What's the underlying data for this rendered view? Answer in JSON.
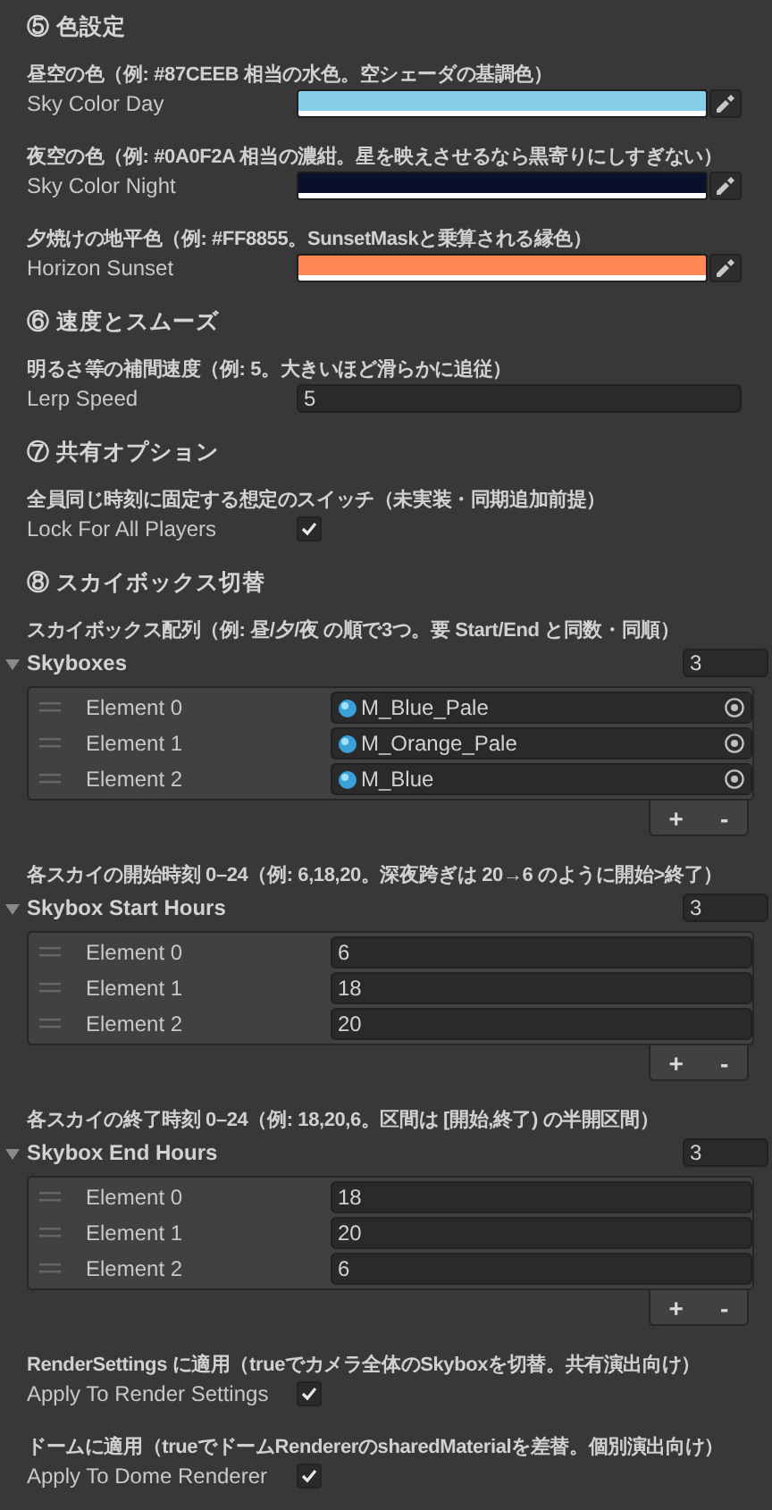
{
  "items": [
    {
      "kind": "section",
      "title": "⑤ 色設定"
    },
    {
      "kind": "color",
      "header": "昼空の色（例: #87CEEB 相当の水色。空シェーダの基調色）",
      "label": "Sky Color Day",
      "color": "#87ceeb"
    },
    {
      "kind": "color",
      "header": "夜空の色（例: #0A0F2A 相当の濃紺。星を映えさせるなら黒寄りにしすぎない）",
      "label": "Sky Color Night",
      "color": "#0a0f2a"
    },
    {
      "kind": "color",
      "header": "夕焼けの地平色（例: #FF8855。SunsetMaskと乗算される縁色）",
      "label": "Horizon Sunset",
      "color": "#ff8855"
    },
    {
      "kind": "section",
      "title": "⑥ 速度とスムーズ"
    },
    {
      "kind": "float",
      "header": "明るさ等の補間速度（例: 5。大きいほど滑らかに追従）",
      "label": "Lerp Speed",
      "value": "5"
    },
    {
      "kind": "section",
      "title": "⑦ 共有オプション"
    },
    {
      "kind": "toggle",
      "header": "全員同じ時刻に固定する想定のスイッチ（未実装・同期追加前提）",
      "label": "Lock For All Players",
      "checked": true
    },
    {
      "kind": "section",
      "title": "⑧ スカイボックス切替"
    },
    {
      "kind": "list",
      "header": "スカイボックス配列（例: 昼/夕/夜 の順で3つ。要 Start/End と同数・同順）",
      "label": "Skyboxes",
      "expanded": true,
      "count": "3",
      "add_button": "+",
      "remove_button": "-",
      "elements": [
        {
          "kind": "object",
          "label": "Element 0",
          "value": "M_Blue_Pale"
        },
        {
          "kind": "object",
          "label": "Element 1",
          "value": "M_Orange_Pale"
        },
        {
          "kind": "object",
          "label": "Element 2",
          "value": "M_Blue"
        }
      ]
    },
    {
      "kind": "list",
      "header": "各スカイの開始時刻 0–24（例: 6,18,20。深夜跨ぎは 20→6 のように開始>終了）",
      "label": "Skybox Start Hours",
      "expanded": true,
      "count": "3",
      "add_button": "+",
      "remove_button": "-",
      "elements": [
        {
          "kind": "number",
          "label": "Element 0",
          "value": "6"
        },
        {
          "kind": "number",
          "label": "Element 1",
          "value": "18"
        },
        {
          "kind": "number",
          "label": "Element 2",
          "value": "20"
        }
      ]
    },
    {
      "kind": "list",
      "header": "各スカイの終了時刻 0–24（例: 18,20,6。区間は [開始,終了) の半開区間）",
      "label": "Skybox End Hours",
      "expanded": true,
      "count": "3",
      "add_button": "+",
      "remove_button": "-",
      "elements": [
        {
          "kind": "number",
          "label": "Element 0",
          "value": "18"
        },
        {
          "kind": "number",
          "label": "Element 1",
          "value": "20"
        },
        {
          "kind": "number",
          "label": "Element 2",
          "value": "6"
        }
      ]
    },
    {
      "kind": "toggle",
      "header": "RenderSettings に適用（trueでカメラ全体のSkyboxを切替。共有演出向け）",
      "label": "Apply To Render Settings",
      "checked": true
    },
    {
      "kind": "toggle",
      "header": "ドームに適用（trueでドームRendererのsharedMaterialを差替。個別演出向け）",
      "label": "Apply To Dome Renderer",
      "checked": true
    }
  ]
}
